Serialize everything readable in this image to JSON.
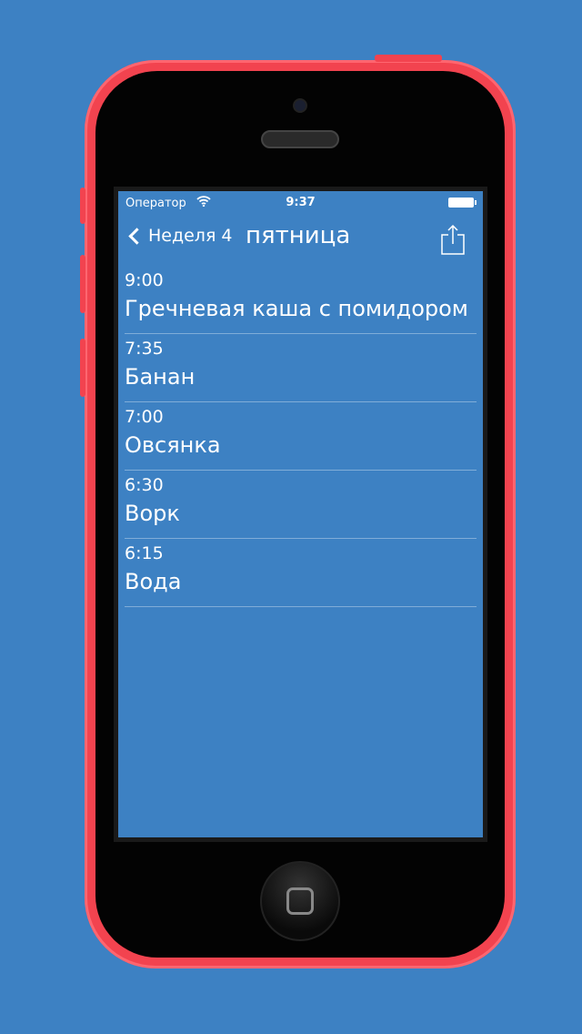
{
  "status": {
    "carrier": "Оператор",
    "time": "9:37"
  },
  "nav": {
    "back_label": "Неделя 4",
    "title": "пятница"
  },
  "items": [
    {
      "time": "9:00",
      "name": "Гречневая каша с помидором"
    },
    {
      "time": "7:35",
      "name": "Банан"
    },
    {
      "time": "7:00",
      "name": "Овсянка"
    },
    {
      "time": "6:30",
      "name": "Ворк"
    },
    {
      "time": "6:15",
      "name": "Вода"
    }
  ],
  "colors": {
    "background": "#3d81c3",
    "phone": "#f2434f"
  }
}
